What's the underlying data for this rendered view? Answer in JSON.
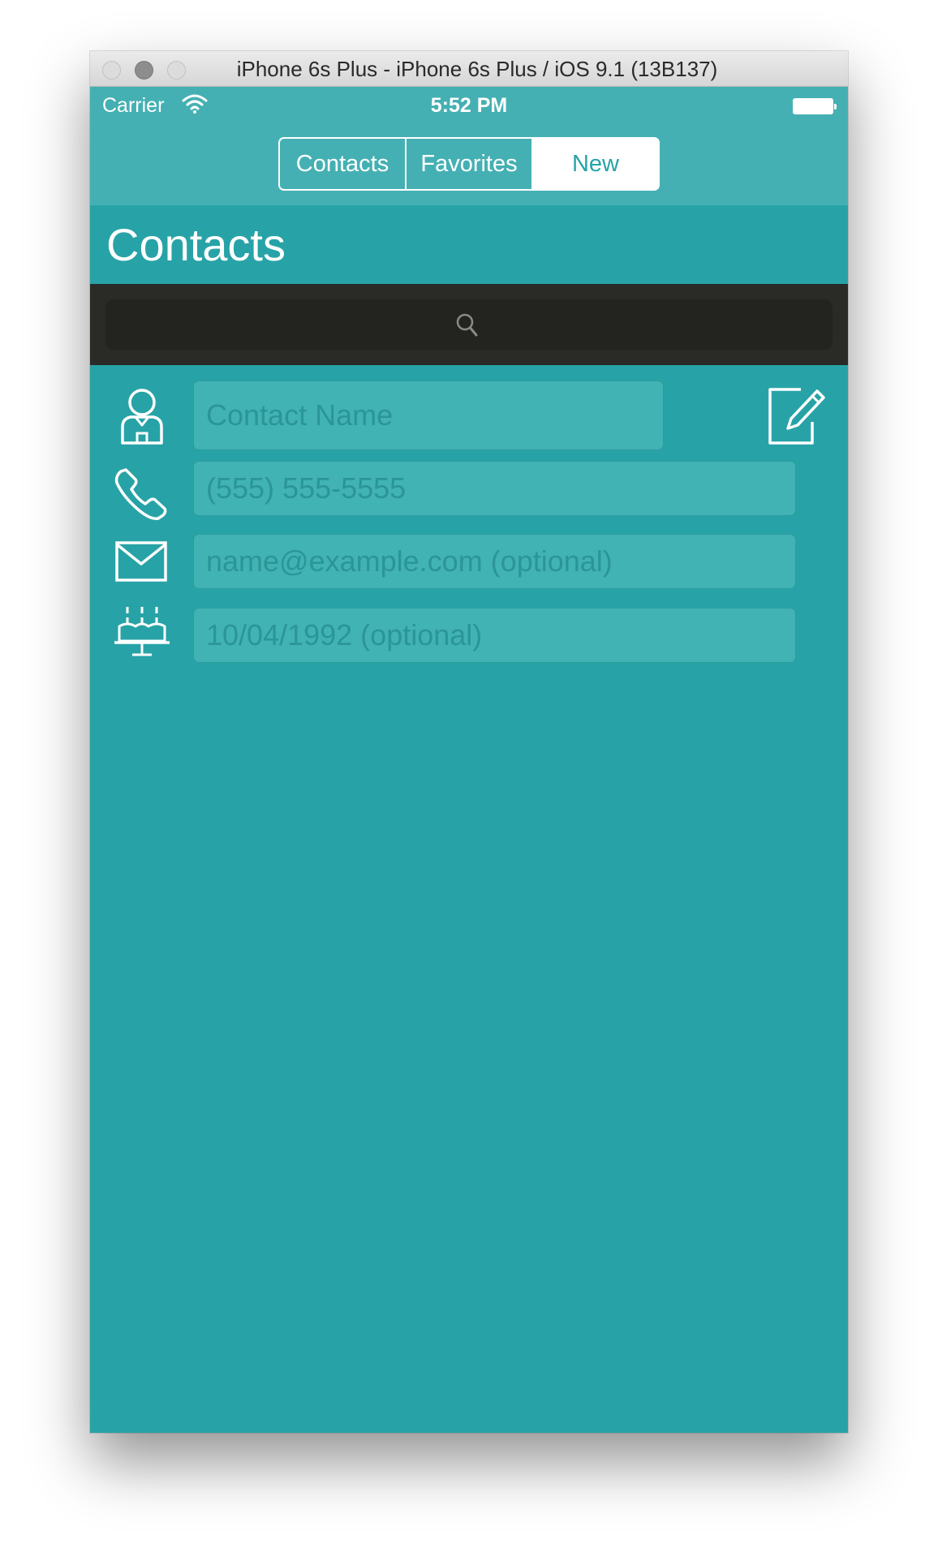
{
  "window": {
    "title": "iPhone 6s Plus - iPhone 6s Plus / iOS 9.1 (13B137)"
  },
  "status_bar": {
    "carrier": "Carrier",
    "time": "5:52 PM"
  },
  "segmented_control": {
    "items": [
      {
        "label": "Contacts",
        "selected": false
      },
      {
        "label": "Favorites",
        "selected": false
      },
      {
        "label": "New",
        "selected": true
      }
    ]
  },
  "header": {
    "title": "Contacts"
  },
  "search": {
    "icon": "search-icon"
  },
  "form": {
    "name": {
      "placeholder": "Contact Name",
      "value": "",
      "icon": "person-icon"
    },
    "phone": {
      "placeholder": "(555) 555-5555",
      "value": "",
      "icon": "phone-icon"
    },
    "email": {
      "placeholder": "name@example.com (optional)",
      "value": "",
      "icon": "mail-icon"
    },
    "birthday": {
      "placeholder": "10/04/1992 (optional)",
      "value": "",
      "icon": "cake-icon"
    },
    "edit_icon": "edit-icon"
  },
  "colors": {
    "background": "#27a3a7",
    "top_bar": "#45b0b3",
    "search_bar": "#2a2a27",
    "field_background": "#41b3b4",
    "placeholder": "#2b9597",
    "foreground": "#ffffff"
  }
}
